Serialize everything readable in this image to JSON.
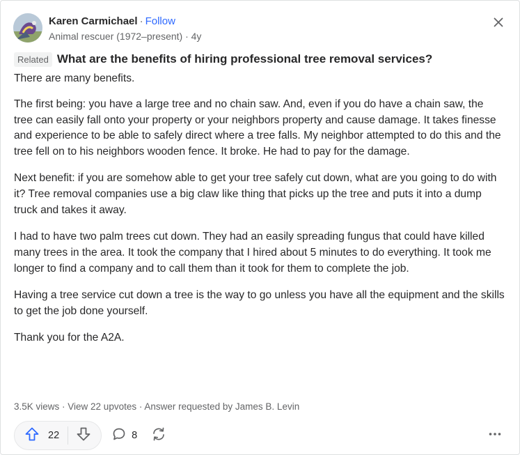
{
  "author": {
    "name": "Karen Carmichael",
    "separator": "·",
    "follow_label": "Follow",
    "credential": "Animal rescuer (1972–present) · 4y"
  },
  "question": {
    "badge": "Related",
    "title": "What are the benefits of hiring professional tree removal services?"
  },
  "answer": {
    "paragraphs": [
      "There are many benefits.",
      "The first being: you have a large tree and no chain saw. And, even if you do have a chain saw, the tree can easily fall onto your property or your neighbors property and cause damage. It takes finesse and experience to be able to safely direct where a tree falls. My neighbor attempted to do this and the tree fell on to his neighbors wooden fence. It broke. He had to pay for the damage.",
      "Next benefit: if you are somehow able to get your tree safely cut down, what are you going to do with it? Tree removal companies use a big claw like thing that picks up the tree and puts it into a dump truck and takes it away.",
      "I had to have two palm trees cut down. They had an easily spreading fungus that could have killed many trees in the area. It took the company that I hired about 5 minutes to do everything. It took me longer to find a company and to call them than it took for them to complete the job.",
      "Having a tree service cut down a tree is the way to go unless you have all the equipment and the skills to get the job done yourself.",
      "Thank you for the A2A."
    ]
  },
  "meta": {
    "text": "3.5K views · View 22 upvotes · Answer requested by James B. Levin"
  },
  "actions": {
    "upvote_count": "22",
    "comment_count": "8"
  },
  "icons": {
    "upvote": "arrow-up-icon",
    "downvote": "arrow-down-icon",
    "comment": "comment-bubble-icon",
    "share": "share-cycle-icon",
    "more": "more-horizontal-icon",
    "close": "close-icon"
  },
  "colors": {
    "accent": "#2e69ff",
    "upvote": "#2e69ff",
    "text": "#282829",
    "muted": "#636466"
  }
}
